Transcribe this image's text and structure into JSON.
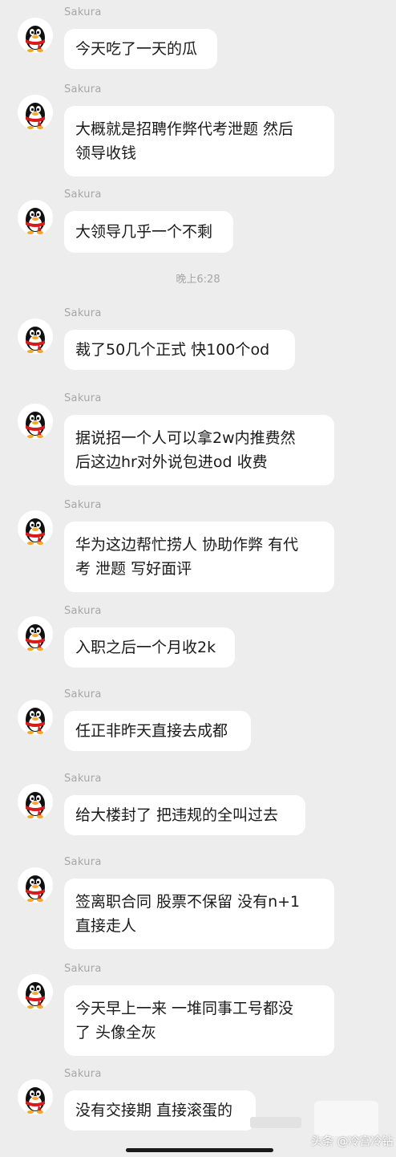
{
  "chat": {
    "sender": "Sakura",
    "timestamp": "晚上6:28",
    "messages": [
      {
        "lines": [
          "今天吃了一天的瓜"
        ]
      },
      {
        "lines": [
          "大概就是招聘作弊代考泄题 然后",
          "领导收钱"
        ]
      },
      {
        "lines": [
          "大领导几乎一个不剩"
        ]
      },
      {
        "lines": [
          "裁了50几个正式 快100个od"
        ]
      },
      {
        "lines": [
          "据说招一个人可以拿2w内推费然",
          "后这边hr对外说包进od 收费"
        ]
      },
      {
        "lines": [
          "华为这边帮忙捞人 协助作弊 有代",
          "考 泄题 写好面评"
        ]
      },
      {
        "lines": [
          "入职之后一个月收2k"
        ]
      },
      {
        "lines": [
          "任正非昨天直接去成都"
        ]
      },
      {
        "lines": [
          "给大楼封了 把违规的全叫过去"
        ]
      },
      {
        "lines": [
          "签离职合同 股票不保留 没有n+1",
          "直接走人"
        ]
      },
      {
        "lines": [
          "今天早上一来 一堆同事工号都没",
          "了 头像全灰"
        ]
      },
      {
        "lines": [
          "没有交接期 直接滚蛋的"
        ]
      }
    ]
  },
  "watermark": "头条 @冷宫冷钻",
  "avatar_icon": "qq-penguin-icon",
  "colors": {
    "background": "#ededed",
    "bubble": "#ffffff",
    "text": "#1a1a1a",
    "meta": "#a6a6a6",
    "scarf": "#d91a1a",
    "beak": "#f5a623"
  }
}
